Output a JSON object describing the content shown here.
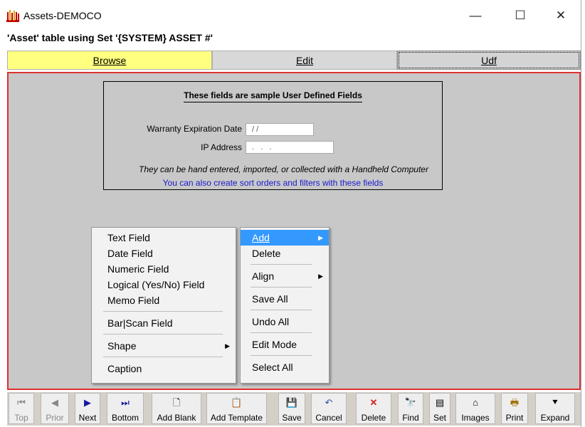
{
  "window": {
    "title": "Assets-DEMOCO",
    "minimize_glyph": "—",
    "maximize_glyph": "☐",
    "close_glyph": "✕",
    "icon": "app-logo-icon"
  },
  "subtitle": "'Asset' table using Set '{SYSTEM} ASSET #'",
  "tabs": {
    "browse": "Browse",
    "edit": "Edit",
    "udf": "Udf"
  },
  "sample": {
    "title": "These fields are sample User Defined Fields",
    "warranty_label": "Warranty Expiration Date",
    "warranty_value": " / /",
    "ip_label": "IP Address",
    "ip_value": " .   .   .",
    "note_line1": "They can be hand entered, imported, or collected with a Handheld Computer",
    "note_line2": "You can also create sort orders and filters with these fields"
  },
  "context_menu": {
    "items": [
      "Add",
      "Delete",
      "Align",
      "Save All",
      "Undo All",
      "Edit Mode",
      "Select All"
    ],
    "highlight_color": "#3399ff"
  },
  "submenu": {
    "items": [
      "Text Field",
      "Date Field",
      "Numeric Field",
      "Logical (Yes/No) Field",
      "Memo Field",
      "Bar|Scan Field",
      "Shape",
      "Caption"
    ]
  },
  "toolbar": {
    "top": "Top",
    "prior": "Prior",
    "next": "Next",
    "bottom": "Bottom",
    "add_blank": "Add Blank",
    "add_template": "Add Template",
    "save": "Save",
    "cancel": "Cancel",
    "delete": "Delete",
    "find": "Find",
    "set": "Set",
    "images": "Images",
    "print": "Print",
    "expand": "Expand"
  },
  "colors": {
    "browse_tab": "#ffff80",
    "main_border": "#e03030",
    "note_blue": "#1a1acc"
  }
}
